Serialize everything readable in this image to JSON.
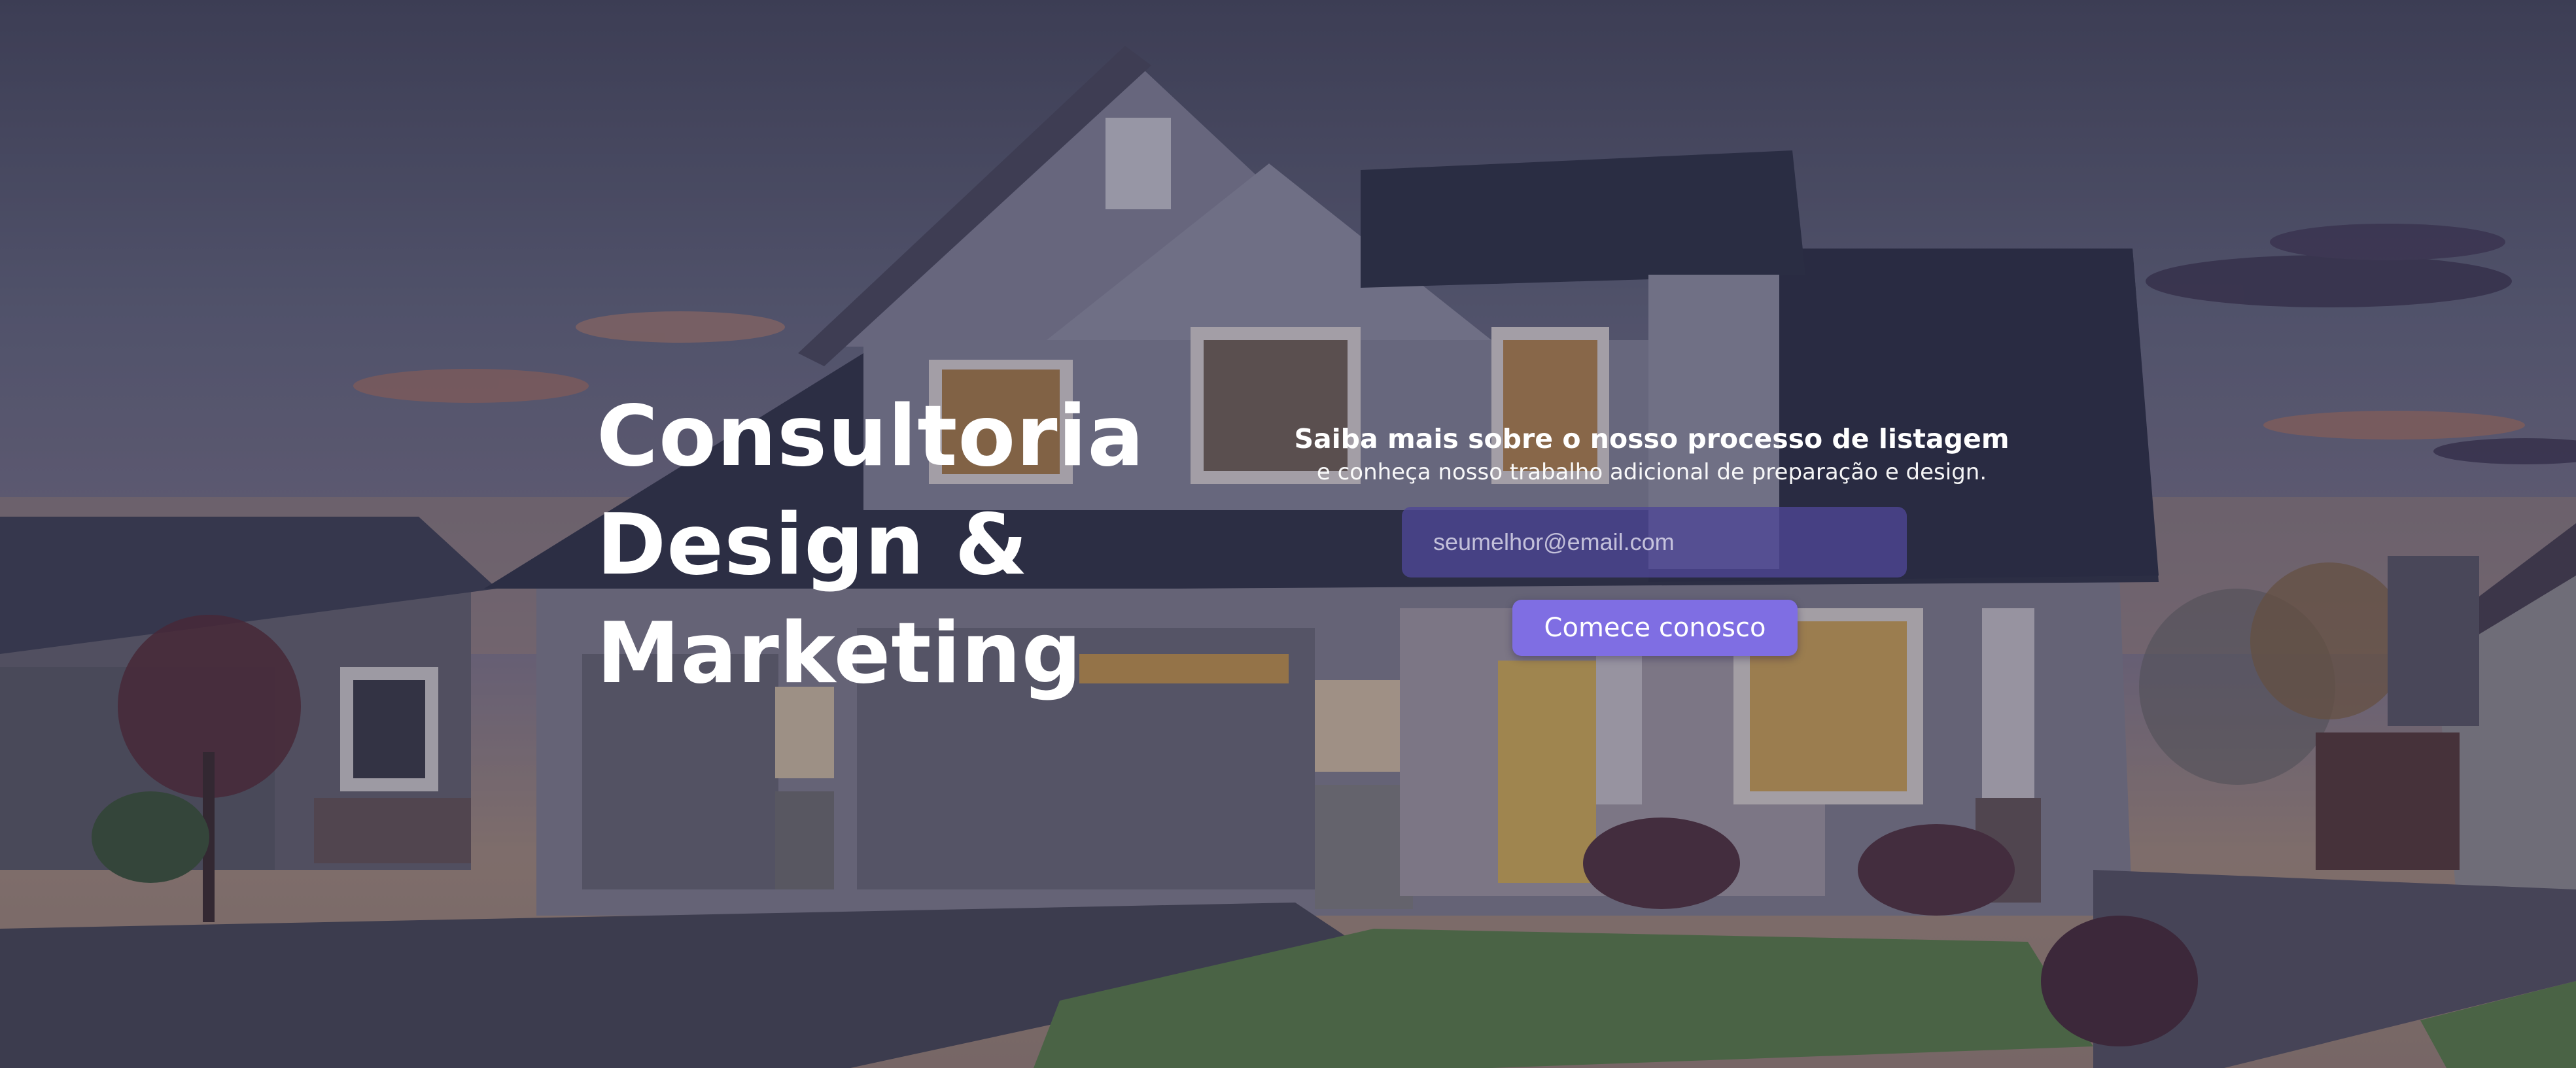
{
  "hero": {
    "title_lines": [
      "Consultoria",
      "Design &",
      "Marketing"
    ],
    "lead_bold": "Saiba mais sobre o nosso processo de listagem",
    "lead_text": "e conheça nosso trabalho adicional de preparação e design.",
    "email_placeholder": "seumelhor@email.com",
    "cta_label": "Comece conosco"
  },
  "colors": {
    "cta_background": "#7f6ee3",
    "email_field_background": "#4e4696",
    "text": "#ffffff"
  },
  "background": {
    "image": "house-at-dusk-photo"
  }
}
